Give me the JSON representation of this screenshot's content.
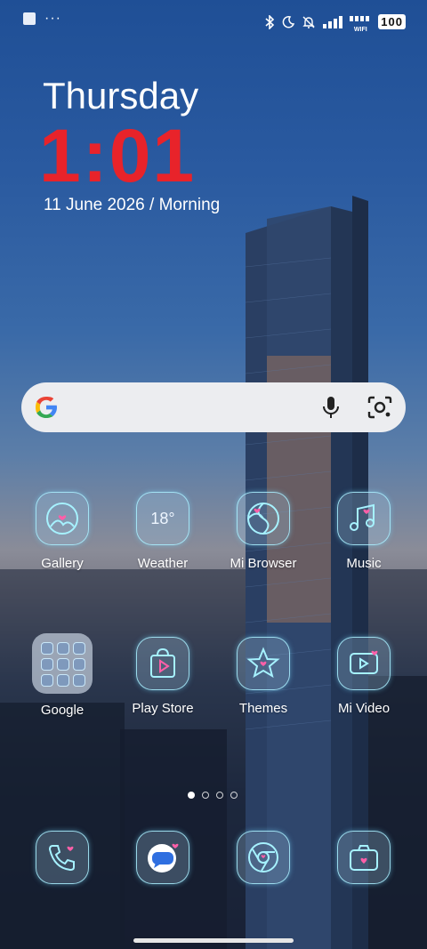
{
  "status_bar": {
    "left_icons": [
      "notification-square-icon",
      "more-dots-icon"
    ],
    "right_icons": [
      "bluetooth-icon",
      "moon-icon",
      "bell-off-icon",
      "signal-icon",
      "wifi-icon"
    ],
    "wifi_label": "WIFI",
    "battery": "100"
  },
  "clock": {
    "day": "Thursday",
    "time": "1:01",
    "date": "11 June 2026 / Morning",
    "time_color": "#e8232a"
  },
  "search": {
    "logo": "google-g-icon",
    "mic": "microphone-icon",
    "lens": "lens-camera-icon"
  },
  "apps_row1": [
    {
      "label": "Gallery",
      "icon": "gallery-icon"
    },
    {
      "label": "Weather",
      "icon": "weather-icon",
      "value": "18°"
    },
    {
      "label": "Mi Browser",
      "icon": "browser-icon"
    },
    {
      "label": "Music",
      "icon": "music-icon"
    }
  ],
  "apps_row2": [
    {
      "label": "Google",
      "icon": "folder-icon"
    },
    {
      "label": "Play Store",
      "icon": "play-store-icon"
    },
    {
      "label": "Themes",
      "icon": "themes-icon"
    },
    {
      "label": "Mi Video",
      "icon": "video-icon"
    }
  ],
  "page_indicator": {
    "pages": 4,
    "current": 1
  },
  "dock": [
    {
      "icon": "phone-icon"
    },
    {
      "icon": "messages-icon"
    },
    {
      "icon": "chrome-icon"
    },
    {
      "icon": "camera-icon"
    }
  ],
  "colors": {
    "neon": "#a6f2ff",
    "heart": "#ff5fa8",
    "search_bg": "#ecedf0"
  }
}
